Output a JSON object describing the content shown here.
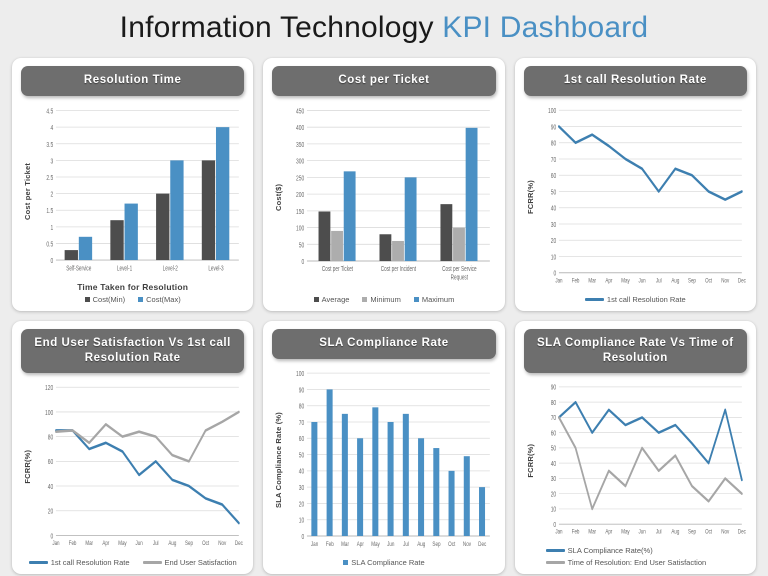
{
  "header": {
    "title_main": "Information Technology ",
    "title_accent": "KPI Dashboard"
  },
  "colors": {
    "blue": "#4a90c4",
    "dark_gray": "#4d4d4d",
    "light_gray": "#adadad",
    "line_gray": "#a6a6a6",
    "header_bar": "#6e6e6e",
    "page_bg": "#ededed",
    "card_bg": "#ffffff",
    "title_accent": "#4a90c4"
  },
  "charts": [
    {
      "id": "resolution-time",
      "title": "Resolution  Time"
    },
    {
      "id": "cost-per-ticket",
      "title": "Cost per Ticket"
    },
    {
      "id": "first-call-resolution-rate",
      "title": "1st call Resolution  Rate"
    },
    {
      "id": "end-user-satisfaction-vs-fcrr",
      "title": "End User Satisfaction  Vs 1st call Resolution  Rate"
    },
    {
      "id": "sla-compliance-rate",
      "title": "SLA  Compliance  Rate"
    },
    {
      "id": "sla-compliance-vs-time-of-resolution",
      "title": "SLA Compliance Rate Vs Time of Resolution"
    }
  ],
  "chart_data": [
    {
      "type": "bar",
      "title": "Resolution  Time",
      "xlabel": "Time Taken for Resolution",
      "ylabel": "Cost per Ticket",
      "categories": [
        "Self-Service",
        "Level-1",
        "Level-2",
        "Level-3"
      ],
      "series": [
        {
          "name": "Cost(Min)",
          "color": "#4d4d4d",
          "values": [
            0.3,
            1.2,
            2.0,
            3.0
          ]
        },
        {
          "name": "Cost(Max)",
          "color": "#4a90c4",
          "values": [
            0.7,
            1.7,
            3.0,
            4.0
          ]
        }
      ],
      "ylim": [
        0,
        4.5
      ],
      "yticks": [
        0,
        0.5,
        1,
        1.5,
        2,
        2.5,
        3,
        3.5,
        4,
        4.5
      ],
      "ytick_labels": [
        "0",
        "0.5",
        "1",
        "1.5",
        "2",
        "2.5",
        "3",
        "3.5",
        "4",
        "4.5"
      ],
      "grid": true,
      "legend_position": "bottom"
    },
    {
      "type": "bar",
      "title": "Cost per Ticket",
      "xlabel": "",
      "ylabel": "Cost($)",
      "categories": [
        "Cost per Ticket",
        "Cost per Incident",
        "Cost per Service Request"
      ],
      "series": [
        {
          "name": "Average",
          "color": "#4d4d4d",
          "values": [
            148,
            80,
            170
          ]
        },
        {
          "name": "Minimum",
          "color": "#adadad",
          "values": [
            90,
            60,
            100
          ]
        },
        {
          "name": "Maximum",
          "color": "#4a90c4",
          "values": [
            268,
            250,
            398
          ]
        }
      ],
      "ylim": [
        0,
        450
      ],
      "yticks": [
        0,
        50,
        100,
        150,
        200,
        250,
        300,
        350,
        400,
        450
      ],
      "ytick_labels": [
        "0",
        "50",
        "100",
        "150",
        "200",
        "250",
        "300",
        "350",
        "400",
        "450"
      ],
      "grid": true,
      "legend_position": "bottom"
    },
    {
      "type": "line",
      "title": "1st call Resolution  Rate",
      "xlabel": "",
      "ylabel": "FCRR(%)",
      "categories": [
        "Jan",
        "Feb",
        "Mar",
        "Apr",
        "May",
        "Jun",
        "Jul",
        "Aug",
        "Sep",
        "Oct",
        "Nov",
        "Dec"
      ],
      "series": [
        {
          "name": "1st call Resolution Rate",
          "color": "#3d7fb0",
          "values": [
            90,
            80,
            85,
            78,
            70,
            64,
            50,
            64,
            60,
            50,
            45,
            50
          ]
        }
      ],
      "ylim": [
        0,
        100
      ],
      "yticks": [
        0,
        10,
        20,
        30,
        40,
        50,
        60,
        70,
        80,
        90,
        100
      ],
      "ytick_labels": [
        "0",
        "10",
        "20",
        "30",
        "40",
        "50",
        "60",
        "70",
        "80",
        "90",
        "100"
      ],
      "grid": true,
      "legend_position": "bottom"
    },
    {
      "type": "line",
      "title": "End User Satisfaction  Vs 1st call Resolution  Rate",
      "xlabel": "",
      "ylabel": "FCRR(%)",
      "categories": [
        "Jan",
        "Feb",
        "Mar",
        "Apr",
        "May",
        "Jun",
        "Jul",
        "Aug",
        "Sep",
        "Oct",
        "Nov",
        "Dec"
      ],
      "series": [
        {
          "name": "1st call Resolution Rate",
          "color": "#3d7fb0",
          "values": [
            85,
            85,
            70,
            75,
            68,
            49,
            60,
            45,
            40,
            30,
            25,
            10
          ]
        },
        {
          "name": "End User Satisfaction",
          "color": "#a6a6a6",
          "values": [
            84,
            85,
            75,
            90,
            80,
            84,
            80,
            65,
            60,
            85,
            92,
            100
          ]
        }
      ],
      "ylim": [
        0,
        120
      ],
      "yticks": [
        0,
        20,
        40,
        60,
        80,
        100,
        120
      ],
      "ytick_labels": [
        "0",
        "20",
        "40",
        "60",
        "80",
        "100",
        "120"
      ],
      "grid": true,
      "legend_position": "bottom"
    },
    {
      "type": "bar",
      "title": "SLA  Compliance  Rate",
      "xlabel": "",
      "ylabel": "SLA Compliance Rate (%)",
      "categories": [
        "Jan",
        "Feb",
        "Mar",
        "Apr",
        "May",
        "Jun",
        "Jul",
        "Aug",
        "Sep",
        "Oct",
        "Nov",
        "Dec"
      ],
      "series": [
        {
          "name": "SLA Compliance Rate",
          "color": "#4a90c4",
          "values": [
            70,
            90,
            75,
            60,
            79,
            70,
            75,
            60,
            54,
            40,
            49,
            30
          ]
        }
      ],
      "ylim": [
        0,
        100
      ],
      "yticks": [
        0,
        10,
        20,
        30,
        40,
        50,
        60,
        70,
        80,
        90,
        100
      ],
      "ytick_labels": [
        "0",
        "10",
        "20",
        "30",
        "40",
        "50",
        "60",
        "70",
        "80",
        "90",
        "100"
      ],
      "grid": true,
      "legend_position": "bottom"
    },
    {
      "type": "line",
      "title": "SLA Compliance Rate Vs Time of Resolution",
      "xlabel": "",
      "ylabel": "FCRR(%)",
      "categories": [
        "Jan",
        "Feb",
        "Mar",
        "Apr",
        "May",
        "Jun",
        "Jul",
        "Aug",
        "Sep",
        "Oct",
        "Nov",
        "Dec"
      ],
      "series": [
        {
          "name": "SLA Compliance Rate(%)",
          "color": "#3d7fb0",
          "values": [
            70,
            80,
            60,
            75,
            65,
            70,
            60,
            65,
            53,
            40,
            75,
            29
          ]
        },
        {
          "name": "Time of Resolution: End User Satisfaction",
          "color": "#a6a6a6",
          "values": [
            70,
            50,
            10,
            35,
            25,
            50,
            35,
            45,
            25,
            15,
            30,
            20
          ]
        }
      ],
      "ylim": [
        0,
        90
      ],
      "yticks": [
        0,
        10,
        20,
        30,
        40,
        50,
        60,
        70,
        80,
        90
      ],
      "ytick_labels": [
        "0",
        "10",
        "20",
        "30",
        "40",
        "50",
        "60",
        "70",
        "80",
        "90"
      ],
      "grid": true,
      "legend_position": "bottom"
    }
  ]
}
